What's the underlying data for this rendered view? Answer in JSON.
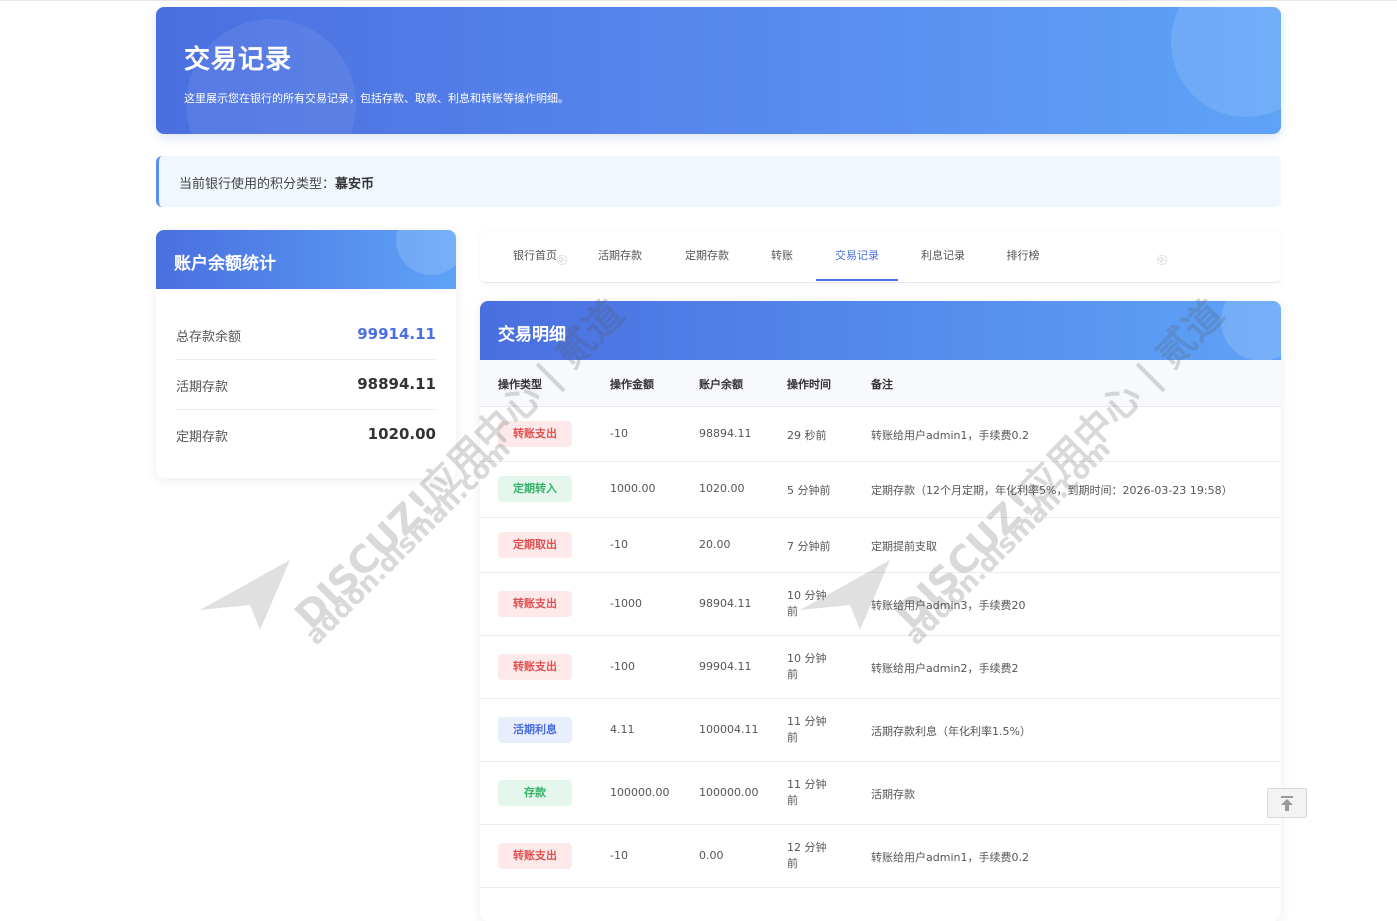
{
  "header": {
    "title": "交易记录",
    "subtitle": "这里展示您在银行的所有交易记录，包括存款、取款、利息和转账等操作明细。"
  },
  "notice": {
    "label": "当前银行使用的积分类型：",
    "currency": "慕安币"
  },
  "stats": {
    "title": "账户余额统计",
    "rows": [
      {
        "label": "总存款余额",
        "value": "99914.11"
      },
      {
        "label": "活期存款",
        "value": "98894.11"
      },
      {
        "label": "定期存款",
        "value": "1020.00"
      }
    ]
  },
  "tabs": [
    {
      "label": "银行首页"
    },
    {
      "label": "活期存款"
    },
    {
      "label": "定期存款"
    },
    {
      "label": "转账"
    },
    {
      "label": "交易记录"
    },
    {
      "label": "利息记录"
    },
    {
      "label": "排行榜"
    }
  ],
  "active_tab": "交易记录",
  "transactions": {
    "title": "交易明细",
    "columns": [
      "操作类型",
      "操作金额",
      "账户余额",
      "操作时间",
      "备注"
    ],
    "rows": [
      {
        "type": "转账支出",
        "amount": "-10",
        "balance": "98894.11",
        "time_a": "29 秒前",
        "time_b": "",
        "note": "转账给用户admin1，手续费0.2"
      },
      {
        "type": "定期转入",
        "amount": "1000.00",
        "balance": "1020.00",
        "time_a": "5 分钟前",
        "time_b": "",
        "note": "定期存款（12个月定期，年化利率5%，到期时间：2026-03-23 19:58）"
      },
      {
        "type": "定期取出",
        "amount": "-10",
        "balance": "20.00",
        "time_a": "7 分钟前",
        "time_b": "",
        "note": "定期提前支取"
      },
      {
        "type": "转账支出",
        "amount": "-1000",
        "balance": "98904.11",
        "time_a": "10 分钟",
        "time_b": "前",
        "note": "转账给用户admin3，手续费20"
      },
      {
        "type": "转账支出",
        "amount": "-100",
        "balance": "99904.11",
        "time_a": "10 分钟",
        "time_b": "前",
        "note": "转账给用户admin2，手续费2"
      },
      {
        "type": "活期利息",
        "amount": "4.11",
        "balance": "100004.11",
        "time_a": "11 分钟",
        "time_b": "前",
        "note": "活期存款利息（年化利率1.5%）"
      },
      {
        "type": "存款",
        "amount": "100000.00",
        "balance": "100000.00",
        "time_a": "11 分钟",
        "time_b": "前",
        "note": "活期存款"
      },
      {
        "type": "转账支出",
        "amount": "-10",
        "balance": "0.00",
        "time_a": "12 分钟",
        "time_b": "前",
        "note": "转账给用户admin1，手续费0.2"
      }
    ]
  },
  "watermark": {
    "line1": "DISCUZ!应用中心 | 贰道",
    "line2": "addon.dismall.com",
    "mark": "®"
  },
  "colors": {
    "accent": "#4a6fe0",
    "red": "#e05252",
    "green": "#35b36a"
  }
}
